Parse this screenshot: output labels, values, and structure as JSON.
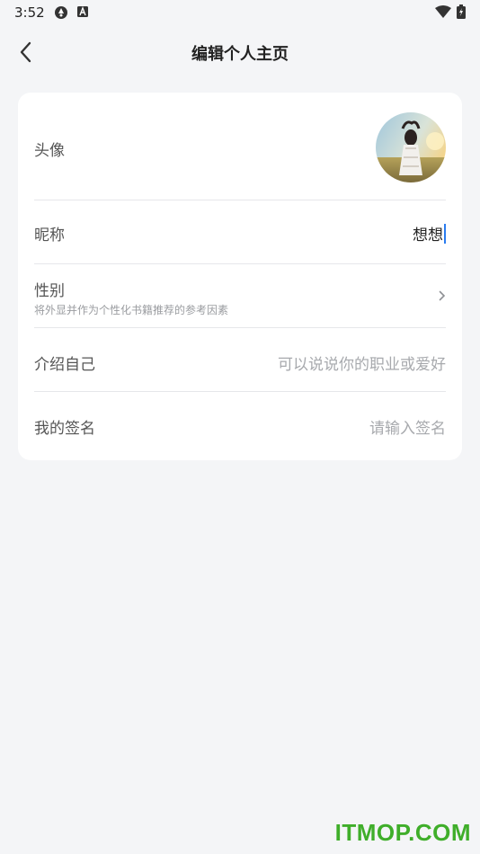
{
  "status_bar": {
    "time": "3:52"
  },
  "header": {
    "title": "编辑个人主页",
    "back_icon": "chevron-left-icon"
  },
  "profile": {
    "avatar_row": {
      "label": "头像"
    },
    "nickname_row": {
      "label": "昵称",
      "value": "想想"
    },
    "gender_row": {
      "label": "性别",
      "hint": "将外显并作为个性化书籍推荐的参考因素",
      "icon": "chevron-right-icon"
    },
    "intro_row": {
      "label": "介绍自己",
      "placeholder": "可以说说你的职业或爱好"
    },
    "signature_row": {
      "label": "我的签名",
      "placeholder": "请输入签名"
    }
  },
  "watermark": {
    "text": "ITMOP.COM"
  },
  "colors": {
    "background": "#f4f5f7",
    "card": "#ffffff",
    "cursor": "#2a7cf0",
    "watermark": "#3fae2a"
  }
}
